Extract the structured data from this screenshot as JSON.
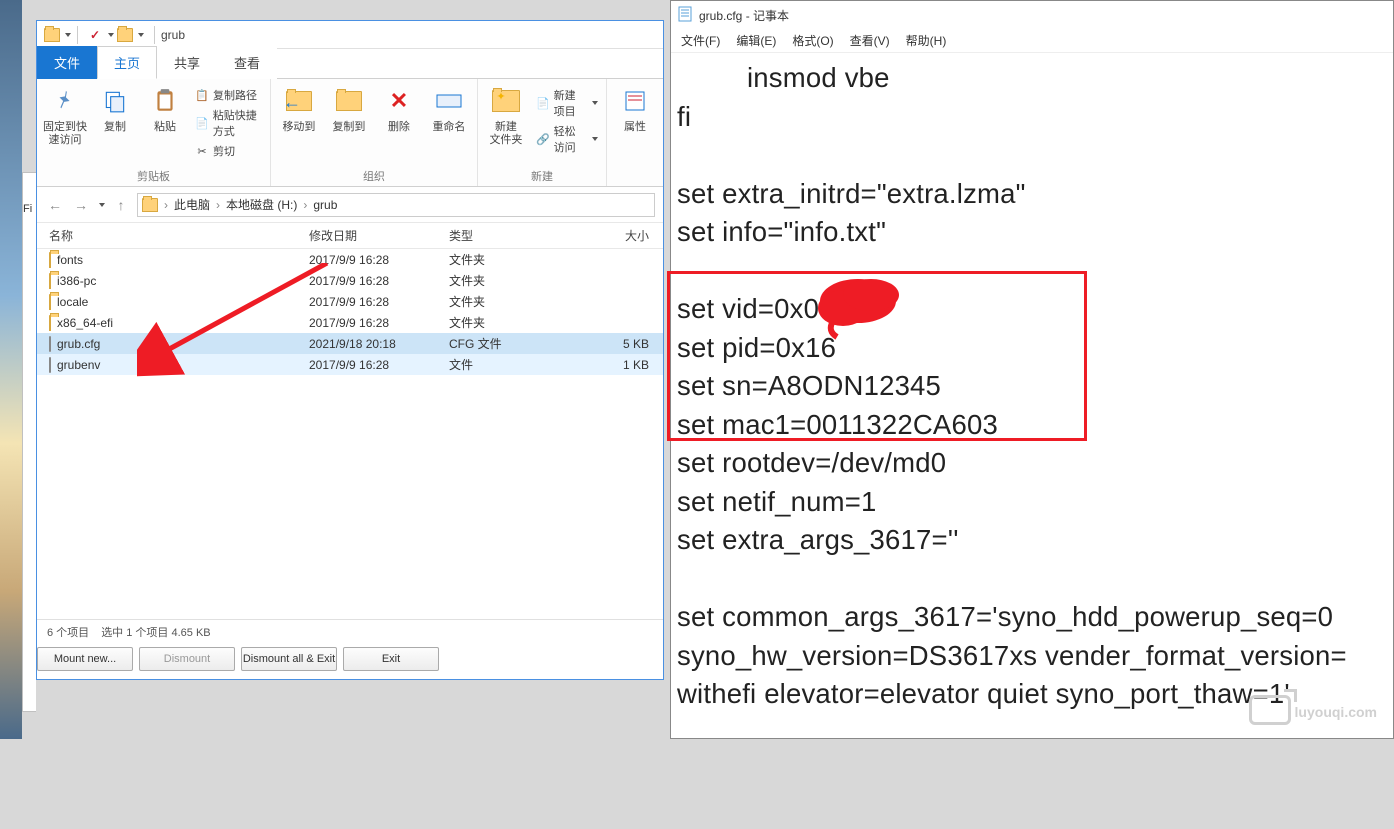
{
  "explorer": {
    "title_path": "grub",
    "tabs": {
      "file": "文件",
      "home": "主页",
      "share": "共享",
      "view": "查看"
    },
    "ribbon": {
      "pin": "固定到快\n速访问",
      "copy": "复制",
      "paste": "粘贴",
      "copy_path": "复制路径",
      "paste_shortcut": "粘贴快捷方式",
      "cut": "剪切",
      "group1": "剪贴板",
      "move_to": "移动到",
      "copy_to": "复制到",
      "delete": "删除",
      "rename": "重命名",
      "group2": "组织",
      "new_folder": "新建\n文件夹",
      "new_item": "新建项目",
      "easy_access": "轻松访问",
      "group3": "新建",
      "properties": "属性"
    },
    "breadcrumb": [
      "此电脑",
      "本地磁盘 (H:)",
      "grub"
    ],
    "columns": {
      "name": "名称",
      "date": "修改日期",
      "type": "类型",
      "size": "大小"
    },
    "rows": [
      {
        "name": "fonts",
        "date": "2017/9/9 16:28",
        "type": "文件夹",
        "size": "",
        "icon": "folder"
      },
      {
        "name": "i386-pc",
        "date": "2017/9/9 16:28",
        "type": "文件夹",
        "size": "",
        "icon": "folder"
      },
      {
        "name": "locale",
        "date": "2017/9/9 16:28",
        "type": "文件夹",
        "size": "",
        "icon": "folder"
      },
      {
        "name": "x86_64-efi",
        "date": "2017/9/9 16:28",
        "type": "文件夹",
        "size": "",
        "icon": "folder"
      },
      {
        "name": "grub.cfg",
        "date": "2021/9/18 20:18",
        "type": "CFG 文件",
        "size": "5 KB",
        "icon": "file",
        "selected": true
      },
      {
        "name": "grubenv",
        "date": "2017/9/9 16:28",
        "type": "文件",
        "size": "1 KB",
        "icon": "file",
        "hovered": true
      }
    ],
    "status": {
      "count": "6 个项目",
      "selected": "选中 1 个项目  4.65 KB"
    },
    "buttons": {
      "mount": "Mount new...",
      "dismount": "Dismount",
      "dismount_all": "Dismount all & Exit",
      "exit": "Exit"
    }
  },
  "left_sliver_text": "Fi",
  "notepad": {
    "title": "grub.cfg - 记事本",
    "menu": [
      "文件(F)",
      "编辑(E)",
      "格式(O)",
      "查看(V)",
      "帮助(H)"
    ],
    "lines": {
      "l1": "insmod vbe",
      "l2": "fi",
      "l3": "",
      "l4": "set extra_initrd=\"extra.lzma\"",
      "l5": "set info=\"info.txt\"",
      "l6": "",
      "l7": "set vid=0x0",
      "l8": "set pid=0x16",
      "l9": "set sn=A8ODN12345",
      "l10": "set mac1=0011322CA603",
      "l11": "set rootdev=/dev/md0",
      "l12": "set netif_num=1",
      "l13": "set extra_args_3617=''",
      "l14": "",
      "l15": "set common_args_3617='syno_hdd_powerup_seq=0",
      "l16": "syno_hw_version=DS3617xs vender_format_version=",
      "l17": "withefi elevator=elevator quiet syno_port_thaw=1'"
    }
  },
  "watermark": "luyouqi.com"
}
